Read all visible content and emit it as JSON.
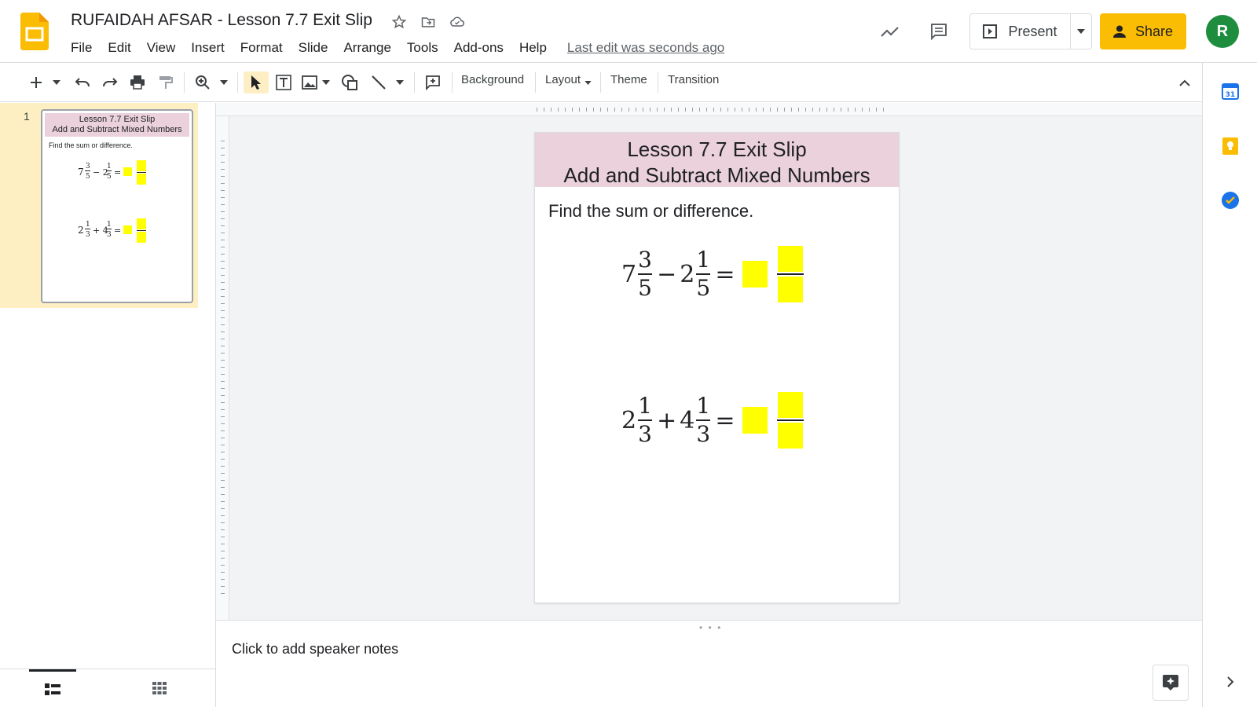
{
  "app": {
    "doc_title": "RUFAIDAH AFSAR - Lesson 7.7 Exit Slip",
    "last_edit": "Last edit was seconds ago",
    "menus": [
      "File",
      "Edit",
      "View",
      "Insert",
      "Format",
      "Slide",
      "Arrange",
      "Tools",
      "Add-ons",
      "Help"
    ],
    "present_label": "Present",
    "share_label": "Share",
    "avatar_letter": "R",
    "brand_color": "#fbbc04"
  },
  "toolbar": {
    "background_label": "Background",
    "layout_label": "Layout",
    "theme_label": "Theme",
    "transition_label": "Transition"
  },
  "filmstrip": {
    "slide_number": "1"
  },
  "slide": {
    "title_line1": "Lesson 7.7 Exit Slip",
    "title_line2": "Add and Subtract Mixed Numbers",
    "prompt": "Find the sum or difference.",
    "header_color": "#ead1dc",
    "answer_box_color": "#ffff00",
    "eq1": {
      "whole1": "7",
      "num1": "3",
      "den1": "5",
      "op": "−",
      "whole2": "2",
      "num2": "1",
      "den2": "5",
      "eq": "="
    },
    "eq2": {
      "whole1": "2",
      "num1": "1",
      "den1": "3",
      "op": "+",
      "whole2": "4",
      "num2": "1",
      "den2": "3",
      "eq": "="
    }
  },
  "notes": {
    "placeholder": "Click to add speaker notes"
  }
}
